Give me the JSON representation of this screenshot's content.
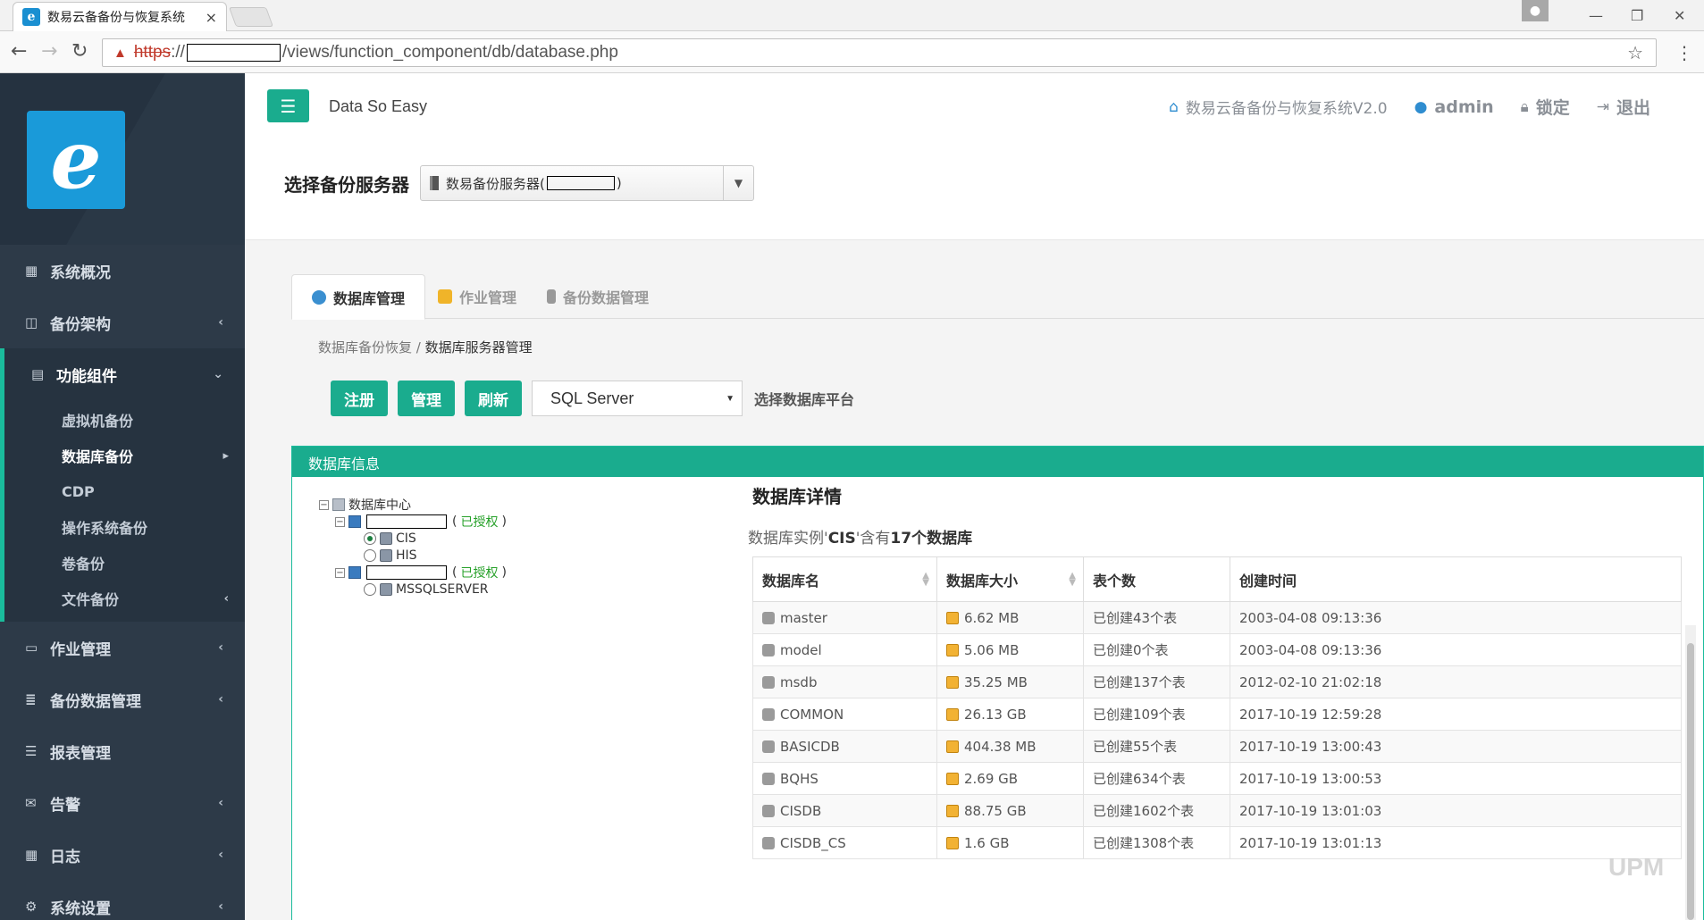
{
  "browser": {
    "tab_title": "数易云备备份与恢复系统",
    "tab_close": "×",
    "url_scheme": "https",
    "url_sep": "://",
    "url_path": "/views/function_component/db/database.php"
  },
  "sidebar": {
    "logo_letter": "e",
    "items": [
      {
        "label": "系统概况",
        "icon": "dashboard-icon",
        "glyph": "▦"
      },
      {
        "label": "备份架构",
        "icon": "columns-icon",
        "glyph": "◫",
        "chevron": "‹"
      },
      {
        "label": "功能组件",
        "icon": "chart-icon",
        "glyph": "▤",
        "chevron": "⌄"
      },
      {
        "label": "作业管理",
        "icon": "desktop-icon",
        "glyph": "▭",
        "chevron": "‹"
      },
      {
        "label": "备份数据管理",
        "icon": "database-icon",
        "glyph": "≣",
        "chevron": "‹"
      },
      {
        "label": "报表管理",
        "icon": "list-icon",
        "glyph": "☰"
      },
      {
        "label": "告警",
        "icon": "envelope-icon",
        "glyph": "✉",
        "chevron": "‹"
      },
      {
        "label": "日志",
        "icon": "table-icon",
        "glyph": "▦",
        "chevron": "‹"
      },
      {
        "label": "系统设置",
        "icon": "gear-icon",
        "glyph": "⚙",
        "chevron": "‹"
      }
    ],
    "subitems": [
      {
        "label": "虚拟机备份"
      },
      {
        "label": "数据库备份",
        "chevron": "▸"
      },
      {
        "label": "CDP"
      },
      {
        "label": "操作系统备份"
      },
      {
        "label": "卷备份"
      },
      {
        "label": "文件备份",
        "chevron": "‹"
      }
    ]
  },
  "header": {
    "brand": "Data So Easy",
    "system_name": "数易云备备份与恢复系统V2.0",
    "user": "admin",
    "lock": "锁定",
    "logout": "退出"
  },
  "server": {
    "label": "选择备份服务器",
    "selected_prefix": "数易备份服务器(",
    "selected_suffix": ")"
  },
  "tabs": [
    {
      "label": "数据库管理",
      "active": true,
      "color": "#3a8fd0"
    },
    {
      "label": "作业管理",
      "active": false,
      "color": "#f0b429"
    },
    {
      "label": "备份数据管理",
      "active": false,
      "color": "#999999"
    }
  ],
  "breadcrumb": {
    "parent": "数据库备份恢复",
    "sep": "/",
    "current": "数据库服务器管理"
  },
  "actions": {
    "register": "注册",
    "manage": "管理",
    "refresh": "刷新",
    "platform_value": "SQL Server",
    "platform_label": "选择数据库平台"
  },
  "panel": {
    "title": "数据库信息"
  },
  "tree": {
    "root": "数据库中心",
    "server1_status_open": "(",
    "server1_status": "已授权",
    "server1_status_close": " )",
    "server1_instances": [
      "CIS",
      "HIS"
    ],
    "server2_status_open": "(",
    "server2_status": "已授权",
    "server2_status_close": " )",
    "server2_instances": [
      "MSSQLSERVER"
    ]
  },
  "details": {
    "title": "数据库详情",
    "summary_prefix": "数据库实例'",
    "instance": "CIS",
    "summary_mid": "'含有",
    "count_text": "17个数据库",
    "columns": [
      "数据库名",
      "数据库大小",
      "表个数",
      "创建时间"
    ],
    "rows": [
      {
        "name": "master",
        "size": "6.62 MB",
        "tables": "已创建43个表",
        "created": "2003-04-08 09:13:36"
      },
      {
        "name": "model",
        "size": "5.06 MB",
        "tables": "已创建0个表",
        "created": "2003-04-08 09:13:36"
      },
      {
        "name": "msdb",
        "size": "35.25 MB",
        "tables": "已创建137个表",
        "created": "2012-02-10 21:02:18"
      },
      {
        "name": "COMMON",
        "size": "26.13 GB",
        "tables": "已创建109个表",
        "created": "2017-10-19 12:59:28"
      },
      {
        "name": "BASICDB",
        "size": "404.38 MB",
        "tables": "已创建55个表",
        "created": "2017-10-19 13:00:43"
      },
      {
        "name": "BQHS",
        "size": "2.69 GB",
        "tables": "已创建634个表",
        "created": "2017-10-19 13:00:53"
      },
      {
        "name": "CISDB",
        "size": "88.75 GB",
        "tables": "已创建1602个表",
        "created": "2017-10-19 13:01:03"
      },
      {
        "name": "CISDB_CS",
        "size": "1.6 GB",
        "tables": "已创建1308个表",
        "created": "2017-10-19 13:01:13"
      }
    ]
  },
  "watermark": "UPM"
}
